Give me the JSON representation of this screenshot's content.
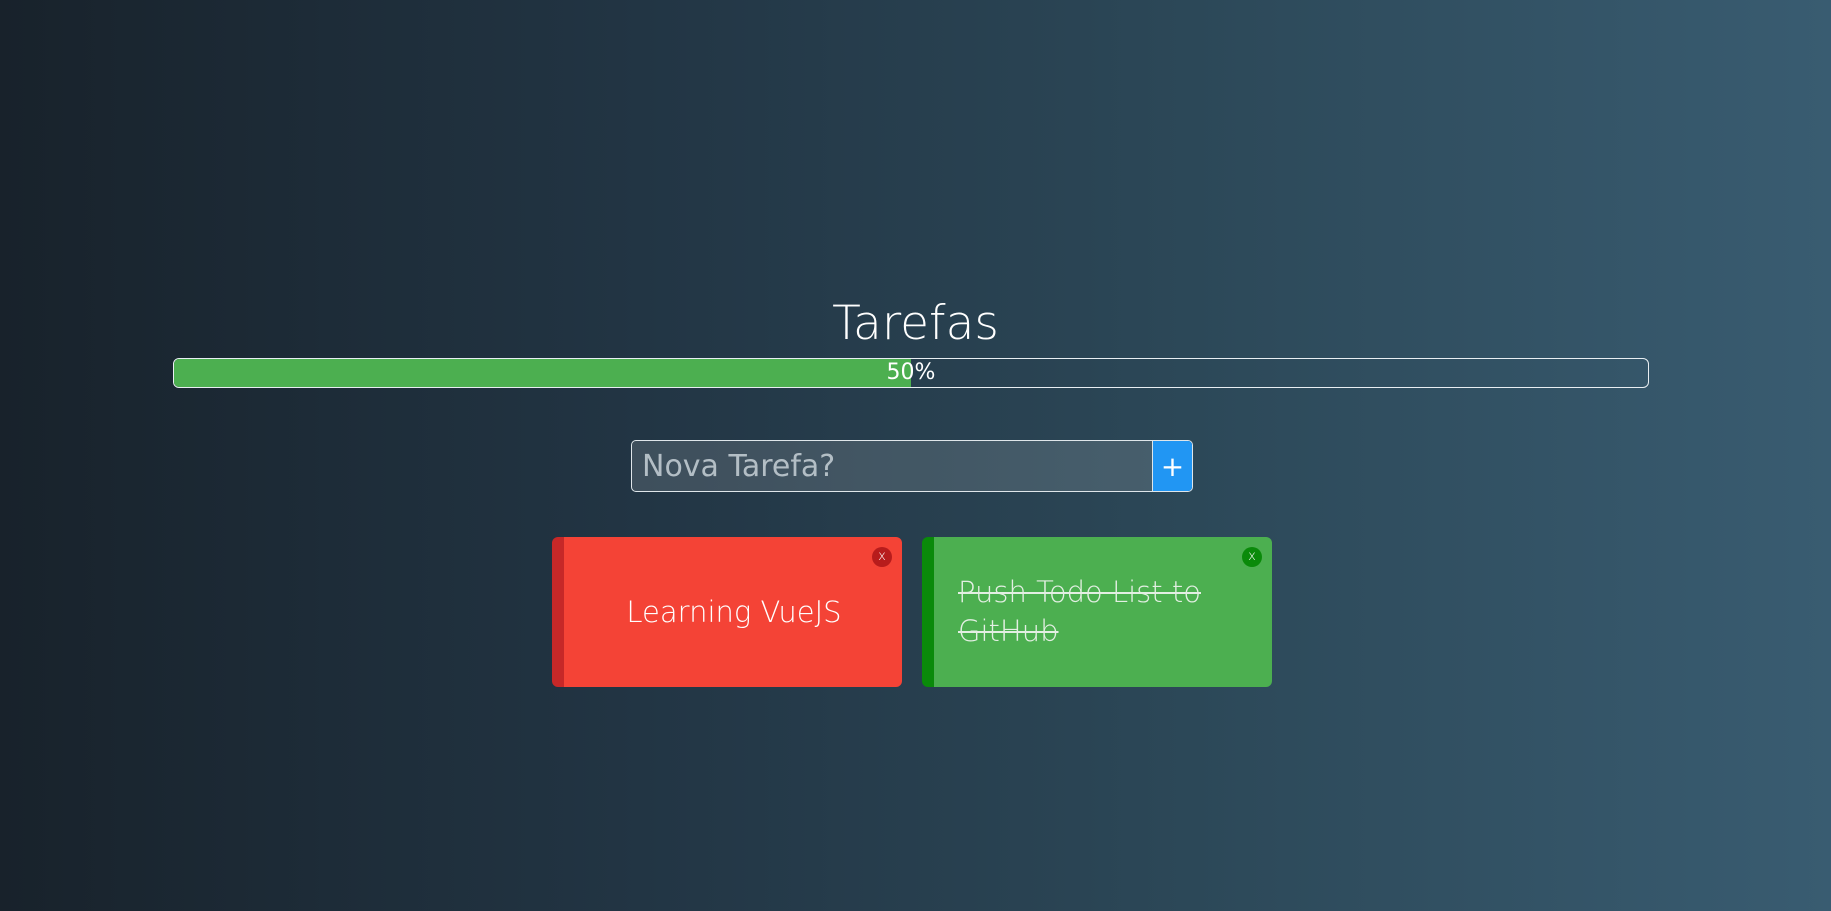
{
  "app": {
    "title": "Tarefas"
  },
  "progress": {
    "percent": 50,
    "label": "50%",
    "fill_color": "#4caf50"
  },
  "new_task": {
    "placeholder": "Nova Tarefa?",
    "value": "",
    "add_label": "+",
    "add_color": "#2196f3"
  },
  "tasks": [
    {
      "label": "Learning VueJS",
      "done": false,
      "close_label": "x",
      "color": "#f44336"
    },
    {
      "label": "Push Todo List to GitHub",
      "done": true,
      "close_label": "x",
      "color": "#4caf50"
    }
  ]
}
